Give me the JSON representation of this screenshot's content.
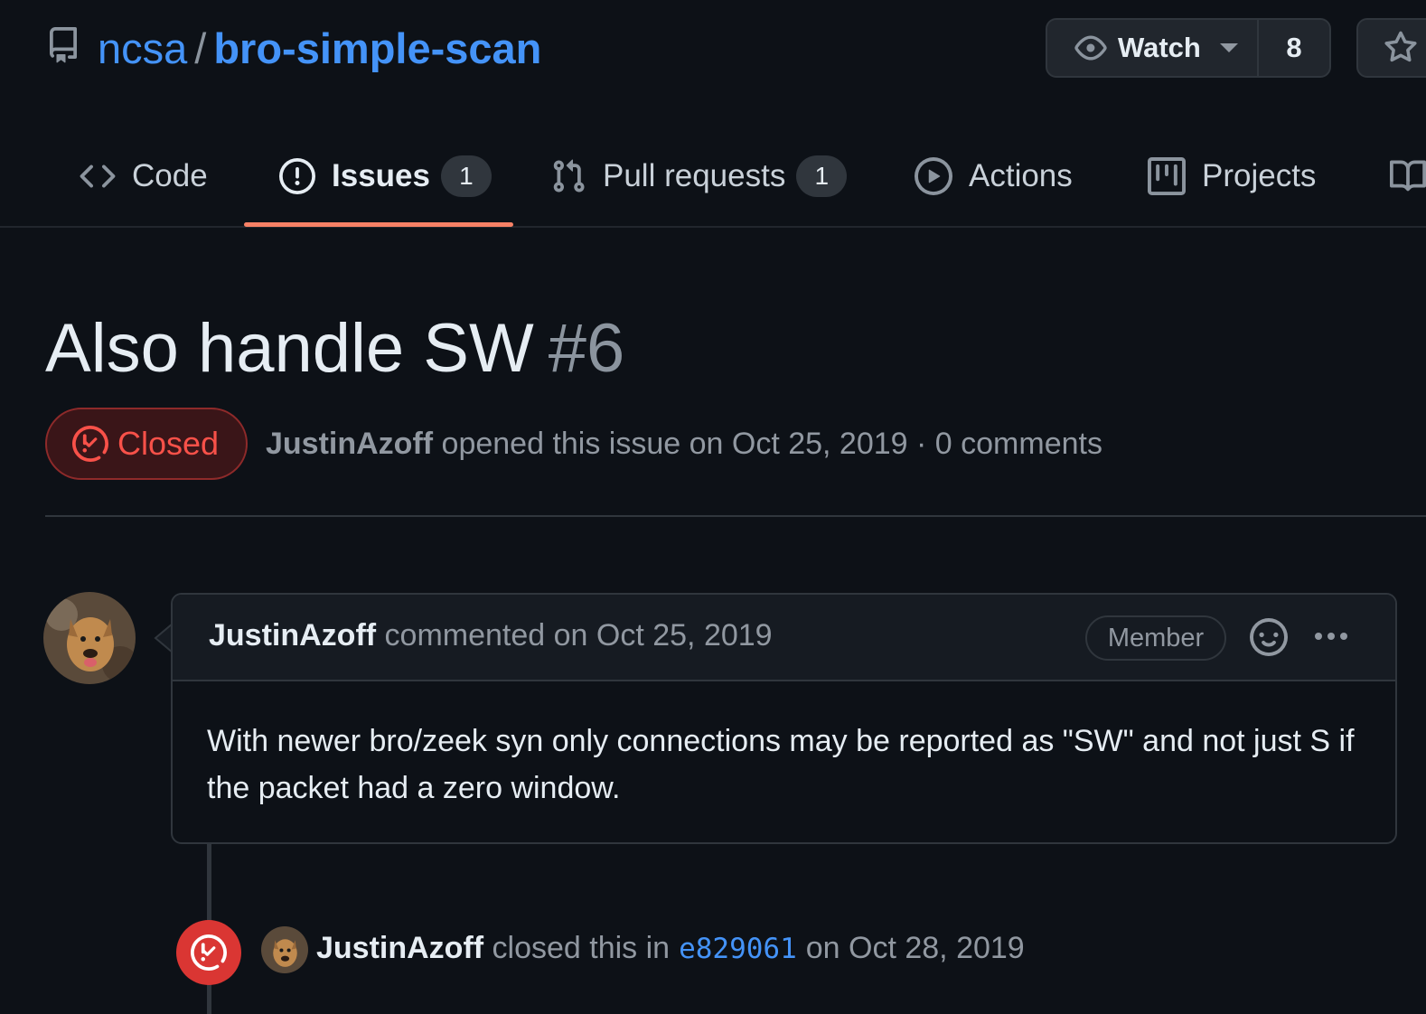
{
  "repo": {
    "owner": "ncsa",
    "separator": "/",
    "name": "bro-simple-scan",
    "icon": "repo-icon"
  },
  "watch": {
    "label": "Watch",
    "count": "8",
    "icon": "eye-icon"
  },
  "star": {
    "icon": "star-icon"
  },
  "tabs": [
    {
      "label": "Code",
      "icon": "code-icon"
    },
    {
      "label": "Issues",
      "icon": "issue-opened-icon",
      "count": "1",
      "selected": true
    },
    {
      "label": "Pull requests",
      "icon": "git-pull-request-icon",
      "count": "1"
    },
    {
      "label": "Actions",
      "icon": "play-icon"
    },
    {
      "label": "Projects",
      "icon": "table-icon"
    },
    {
      "label": "",
      "icon": "book-icon"
    }
  ],
  "issue": {
    "title": "Also handle SW",
    "number": "#6",
    "state": "Closed",
    "author": "JustinAzoff",
    "opened_text": "opened this issue on Oct 25, 2019 · 0 comments"
  },
  "comment": {
    "author": "JustinAzoff",
    "meta": "commented on Oct 25, 2019",
    "role_badge": "Member",
    "body": "With newer bro/zeek syn only connections may be reported as \"SW\" and not just S if the packet had a zero window."
  },
  "event": {
    "author": "JustinAzoff",
    "action": "closed this in",
    "commit": "e829061",
    "date": "on Oct 28, 2019"
  },
  "colors": {
    "accent_link": "#4493f8",
    "closed": "#f85149",
    "tab_underline": "#f78166",
    "background": "#0d1117"
  }
}
